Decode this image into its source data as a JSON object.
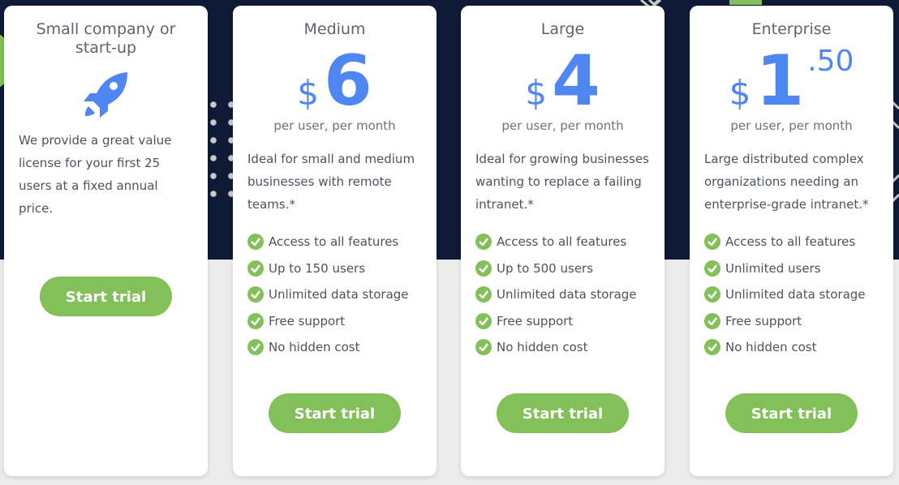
{
  "colors": {
    "accent": "#4f86f2",
    "button": "#84c05a",
    "band": "#0f1a36"
  },
  "plans": [
    {
      "title": "Small company or start-up",
      "icon": "rocket-icon",
      "description": "We provide a great value license for your first 25 users at a fixed annual price.",
      "button": "Start trial"
    },
    {
      "title": "Medium",
      "currency": "$",
      "amount": "6",
      "cents": "",
      "period": "per user, per month",
      "description": "Ideal for small and medium businesses with remote teams.*",
      "features": [
        "Access to all features",
        "Up to 150 users",
        "Unlimited data storage",
        "Free support",
        "No hidden cost"
      ],
      "button": "Start trial"
    },
    {
      "title": "Large",
      "currency": "$",
      "amount": "4",
      "cents": "",
      "period": "per user, per month",
      "description": "Ideal for growing businesses wanting to replace a failing intranet.*",
      "features": [
        "Access to all features",
        "Up to 500 users",
        "Unlimited data storage",
        "Free support",
        "No hidden cost"
      ],
      "button": "Start trial"
    },
    {
      "title": "Enterprise",
      "currency": "$",
      "amount": "1",
      "cents": ".50",
      "period": "per user, per month",
      "description": "Large distributed complex organizations needing an enterprise-grade intranet.*",
      "features": [
        "Access to all features",
        "Unlimited users",
        "Unlimited data storage",
        "Free support",
        "No hidden cost"
      ],
      "button": "Start trial"
    }
  ]
}
